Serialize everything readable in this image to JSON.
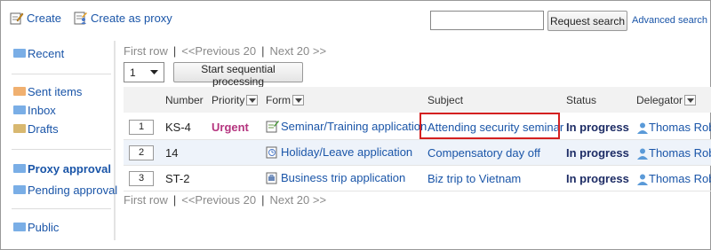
{
  "toolbar": {
    "create_label": "Create",
    "create_proxy_label": "Create as proxy"
  },
  "search": {
    "value": "",
    "button_label": "Request search",
    "advanced_label": "Advanced search"
  },
  "sidebar": {
    "items": [
      {
        "label": "Recent",
        "folder_color": "#7aaee6"
      },
      {
        "label": "Sent items",
        "folder_color": "#f0b070"
      },
      {
        "label": "Inbox",
        "folder_color": "#7aaee6"
      },
      {
        "label": "Drafts",
        "folder_color": "#d8b870"
      },
      {
        "label": "Proxy approval",
        "folder_color": "#7aaee6"
      },
      {
        "label": "Pending approval",
        "folder_color": "#7aaee6"
      },
      {
        "label": "Public",
        "folder_color": "#7aaee6"
      }
    ]
  },
  "pager": {
    "first": "First row",
    "previous": "<<Previous 20",
    "next": "Next 20 >>",
    "separator": "|"
  },
  "batch": {
    "selected_count": "1",
    "start_label": "Start sequential processing"
  },
  "table": {
    "headers": {
      "number": "Number",
      "priority": "Priority",
      "form": "Form",
      "subject": "Subject",
      "status": "Status",
      "delegator": "Delegator"
    },
    "rows": [
      {
        "index": "1",
        "number": "KS-4",
        "priority": "Urgent",
        "form": "Seminar/Training application",
        "form_icon": "seminar-form-icon",
        "subject": "Attending security seminar",
        "status": "In progress",
        "delegator": "Thomas Rob"
      },
      {
        "index": "2",
        "number": "14",
        "priority": "",
        "form": "Holiday/Leave application",
        "form_icon": "holiday-form-icon",
        "subject": "Compensatory day off",
        "status": "In progress",
        "delegator": "Thomas Rob"
      },
      {
        "index": "3",
        "number": "ST-2",
        "priority": "",
        "form": "Business trip application",
        "form_icon": "business-trip-form-icon",
        "subject": "Biz trip to Vietnam",
        "status": "In progress",
        "delegator": "Thomas Rob"
      }
    ]
  },
  "colors": {
    "link": "#1a55a8",
    "urgent": "#b5357f",
    "status": "#1e2d66",
    "highlight": "#d42020"
  }
}
